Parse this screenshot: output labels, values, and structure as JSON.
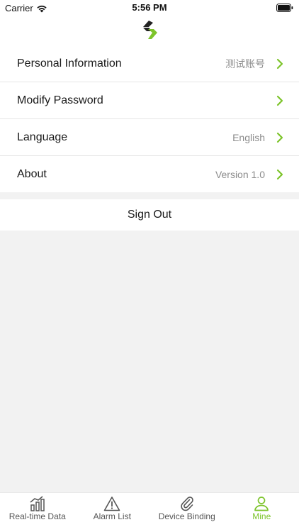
{
  "status_bar": {
    "carrier": "Carrier",
    "time": "5:56 PM"
  },
  "header": {
    "logo_icon": "brand-chevron-logo"
  },
  "settings": {
    "items": [
      {
        "label": "Personal Information",
        "value": "测试账号"
      },
      {
        "label": "Modify Password",
        "value": ""
      },
      {
        "label": "Language",
        "value": "English"
      },
      {
        "label": "About",
        "value": "Version 1.0"
      }
    ],
    "sign_out_label": "Sign Out"
  },
  "tab_bar": {
    "tabs": [
      {
        "label": "Real-time Data",
        "icon": "bar-chart-icon"
      },
      {
        "label": "Alarm List",
        "icon": "warning-triangle-icon"
      },
      {
        "label": "Device Binding",
        "icon": "paperclip-icon"
      },
      {
        "label": "Mine",
        "icon": "person-icon"
      }
    ],
    "active_tab": "Mine"
  },
  "colors": {
    "accent": "#7dc42b",
    "logo_dark": "#222222",
    "background": "#f2f2f2"
  }
}
